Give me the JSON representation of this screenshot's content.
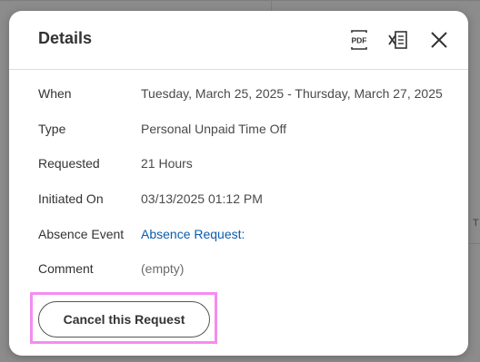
{
  "dialog": {
    "title": "Details",
    "header_icons": [
      "pdf-icon",
      "excel-icon",
      "close-icon"
    ],
    "pdf_icon_text": "PDF"
  },
  "details": [
    {
      "label": "When",
      "value": "Tuesday, March 25, 2025 - Thursday, March 27, 2025",
      "kind": "text"
    },
    {
      "label": "Type",
      "value": "Personal Unpaid Time Off",
      "kind": "text"
    },
    {
      "label": "Requested",
      "value": "21 Hours",
      "kind": "text"
    },
    {
      "label": "Initiated On",
      "value": "03/13/2025 01:12 PM",
      "kind": "text"
    },
    {
      "label": "Absence Event",
      "value": "Absence Request:",
      "kind": "link"
    },
    {
      "label": "Comment",
      "value": "(empty)",
      "kind": "muted"
    }
  ],
  "actions": {
    "cancel_label": "Cancel this Request"
  },
  "colors": {
    "link": "#0b5cab",
    "highlight": "#f58cf0",
    "overlay": "#8c8c8c"
  }
}
